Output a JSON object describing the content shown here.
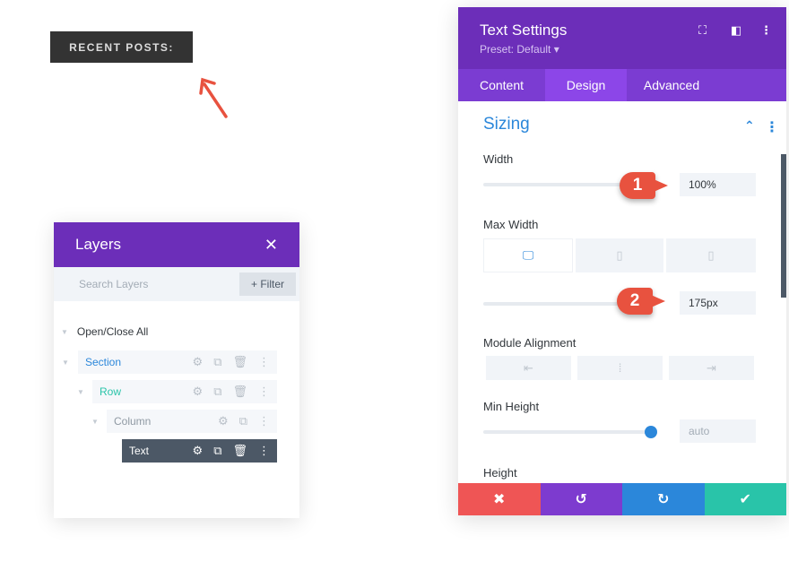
{
  "recent_posts": "RECENT POSTS:",
  "layers": {
    "title": "Layers",
    "search_placeholder": "Search Layers",
    "filter": "+ Filter",
    "open_close": "Open/Close All",
    "items": [
      {
        "label": "Section",
        "color": "#2b87da"
      },
      {
        "label": "Row",
        "color": "#29c4a9"
      },
      {
        "label": "Column",
        "color": "#8f99a3"
      },
      {
        "label": "Text",
        "color": "#ffffff"
      }
    ]
  },
  "settings": {
    "title": "Text Settings",
    "preset": "Preset: Default ▾",
    "tabs": [
      "Content",
      "Design",
      "Advanced"
    ],
    "active_tab": "Design",
    "section": "Sizing",
    "width_label": "Width",
    "width_value": "100%",
    "max_width_label": "Max Width",
    "max_width_value": "175px",
    "module_alignment_label": "Module Alignment",
    "min_height_label": "Min Height",
    "min_height_value": "auto",
    "height_label": "Height",
    "badges": [
      "1",
      "2"
    ]
  },
  "colors": {
    "purple": "#6c2eb9",
    "cancel": "#ef5555",
    "undo": "#7d3bcf",
    "redo": "#2b87da",
    "save": "#29c4a9"
  }
}
